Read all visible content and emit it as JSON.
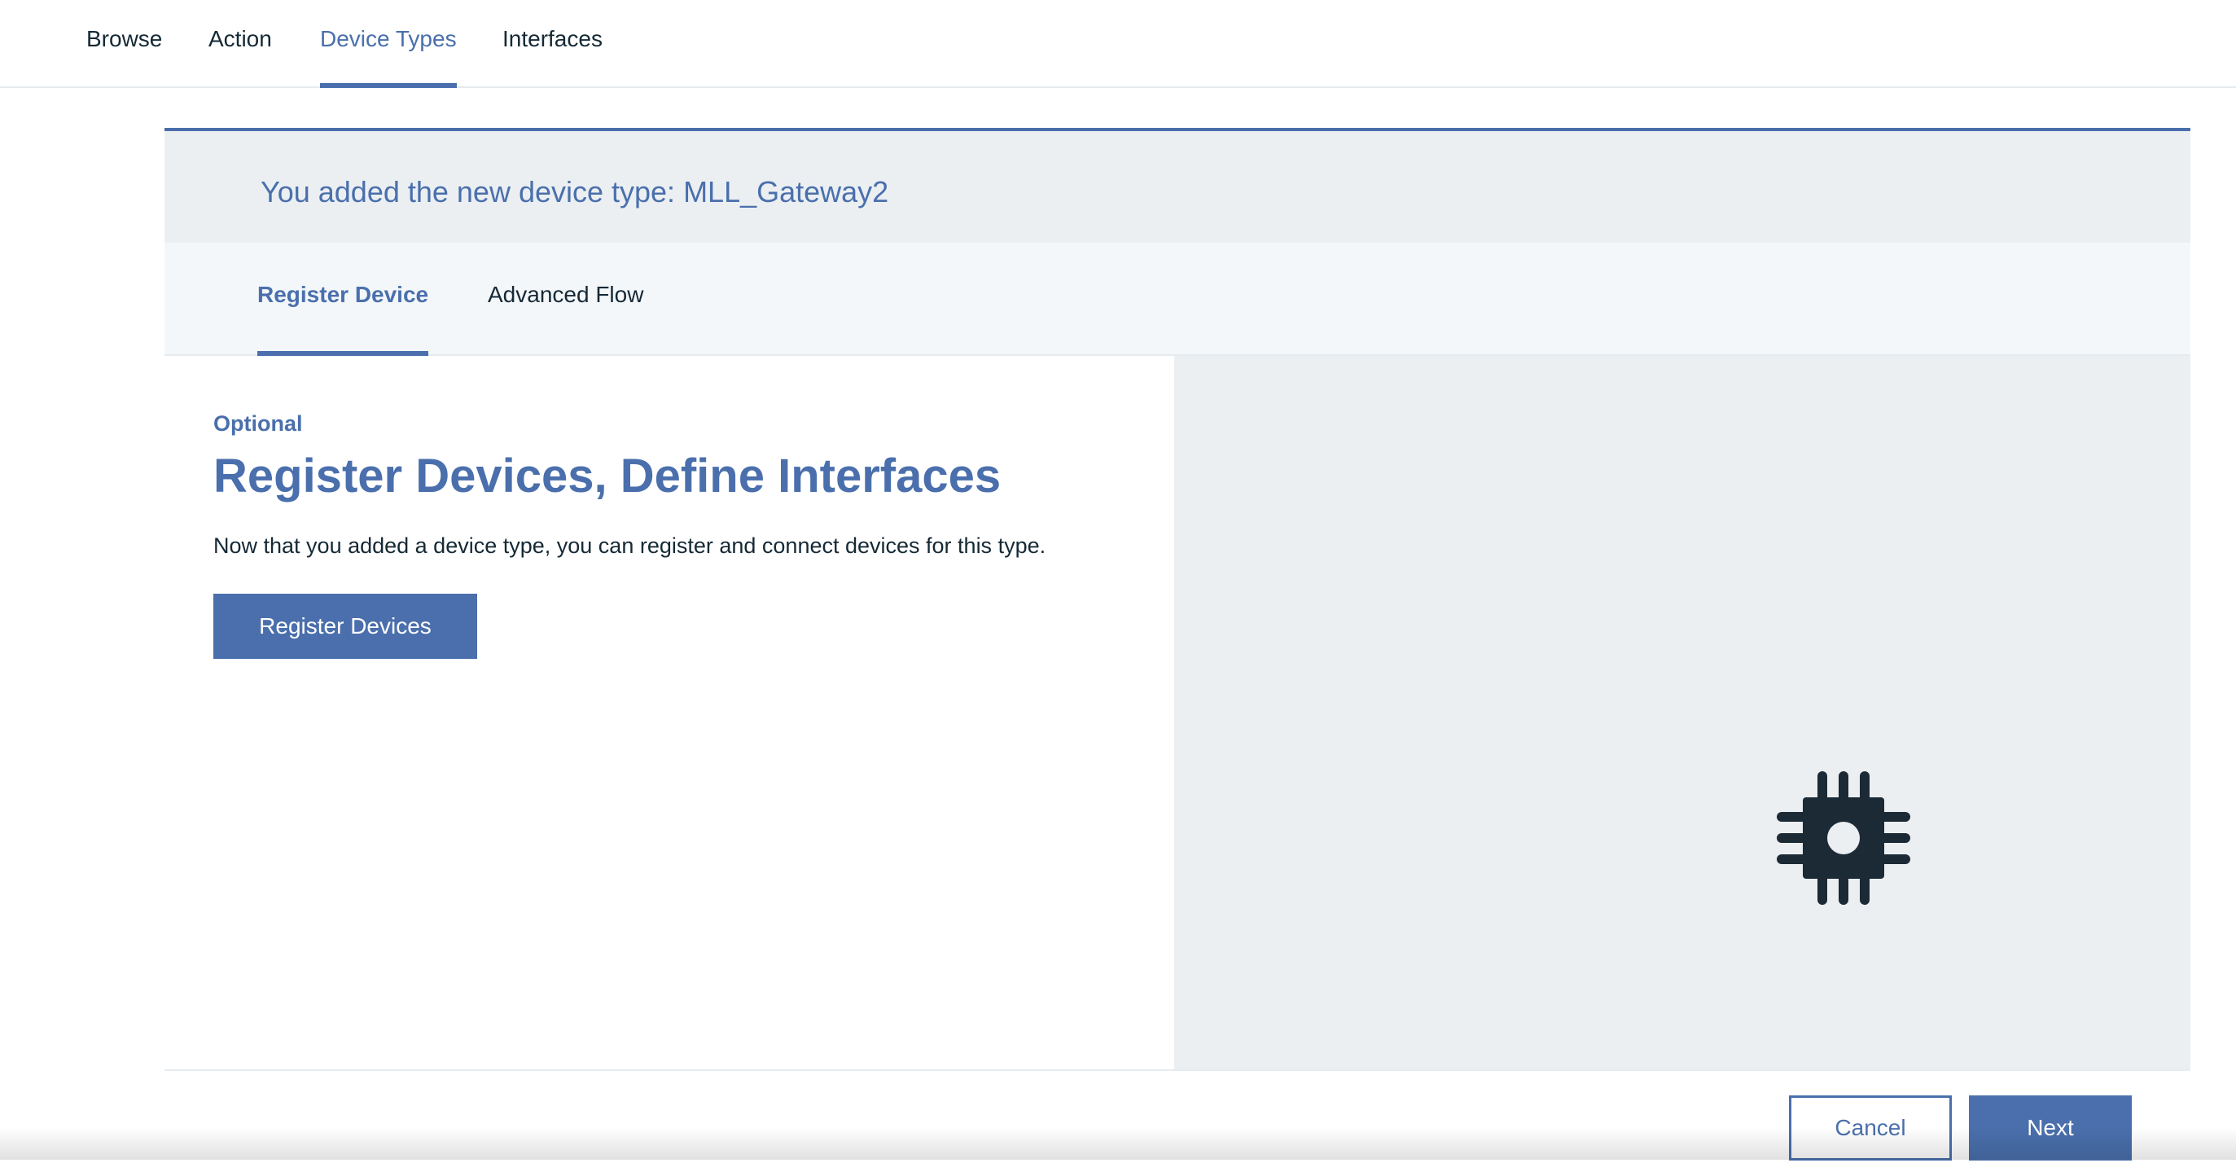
{
  "top_nav": {
    "tabs": [
      {
        "label": "Browse"
      },
      {
        "label": "Action"
      },
      {
        "label": "Device Types",
        "active": true
      },
      {
        "label": "Interfaces"
      }
    ]
  },
  "banner": {
    "message": "You added the new device type: MLL_Gateway2"
  },
  "sub_tabs": [
    {
      "label": "Register Device",
      "active": true
    },
    {
      "label": "Advanced Flow"
    }
  ],
  "content": {
    "optional_label": "Optional",
    "heading": "Register Devices, Define Interfaces",
    "description": "Now that you added a device type, you can register and connect devices for this type.",
    "register_button_label": "Register Devices",
    "illustration_icon": "chip-icon"
  },
  "footer": {
    "cancel_label": "Cancel",
    "next_label": "Next"
  },
  "colors": {
    "accent": "#4a6fac",
    "text": "#152935",
    "panel_bg": "#ebeff2",
    "subtab_bg": "#f4f7fa",
    "icon": "#1c2a36"
  }
}
